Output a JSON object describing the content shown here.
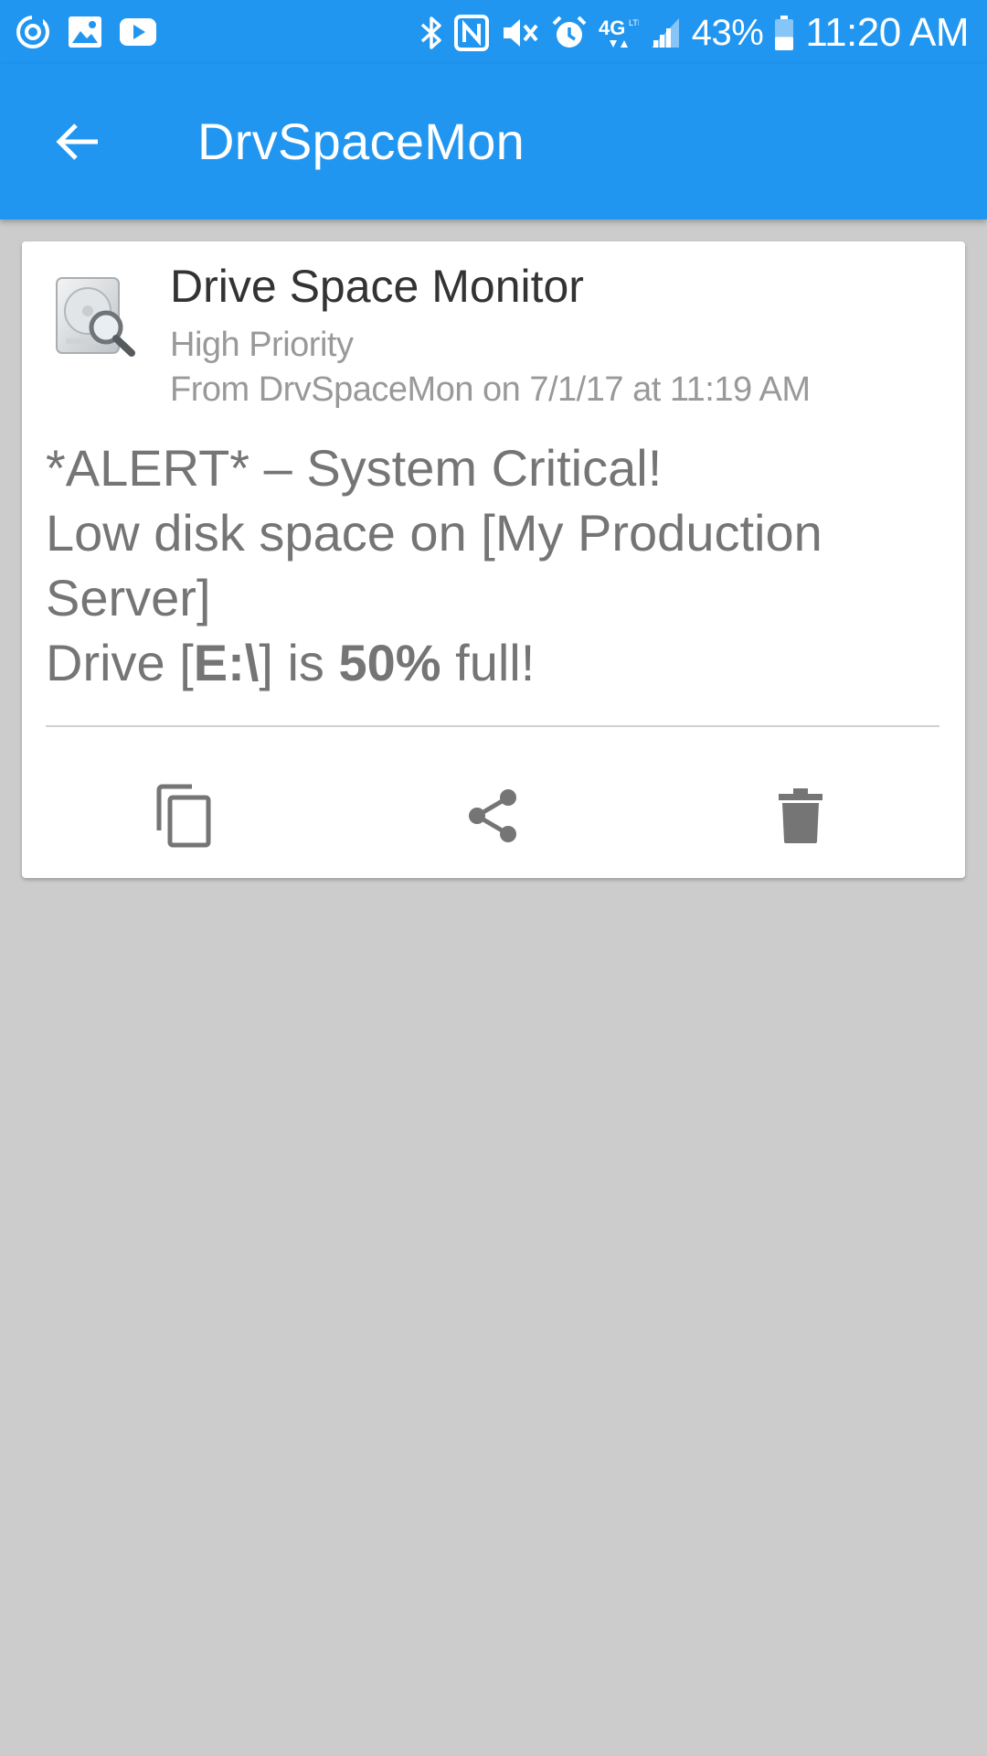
{
  "status_bar": {
    "left_icons": [
      "target-icon",
      "gallery-icon",
      "youtube-icon"
    ],
    "right_icons": [
      "bluetooth-icon",
      "nfc-icon",
      "vibrate-icon",
      "alarm-icon",
      "network-4g-lte-icon",
      "signal-icon"
    ],
    "network_label": "4G",
    "battery_percent": "43%",
    "battery_level": 0.43,
    "time": "11:20 AM"
  },
  "app_bar": {
    "back_icon": "arrow-back-icon",
    "title": "DrvSpaceMon"
  },
  "notification": {
    "icon": "disk-monitor-icon",
    "title": "Drive Space Monitor",
    "priority": "High Priority",
    "from_line": "From DrvSpaceMon on 7/1/17 at 11:19 AM",
    "message": {
      "line1": "*ALERT* – System Critical!",
      "line2": "Low disk space on [My Production Server]",
      "line3_prefix": "Drive [",
      "line3_drive": "E:\\",
      "line3_mid": "] is ",
      "line3_percent": "50%",
      "line3_suffix": " full!"
    },
    "actions": [
      {
        "name": "copy",
        "icon": "copy-icon"
      },
      {
        "name": "share",
        "icon": "share-icon"
      },
      {
        "name": "delete",
        "icon": "delete-icon"
      }
    ]
  },
  "colors": {
    "app_bar": "#2196f0",
    "background": "#cccccc",
    "card": "#ffffff",
    "title_text": "#333333",
    "secondary_text": "#999999",
    "message_text": "#757575",
    "action_icon": "#757575"
  }
}
